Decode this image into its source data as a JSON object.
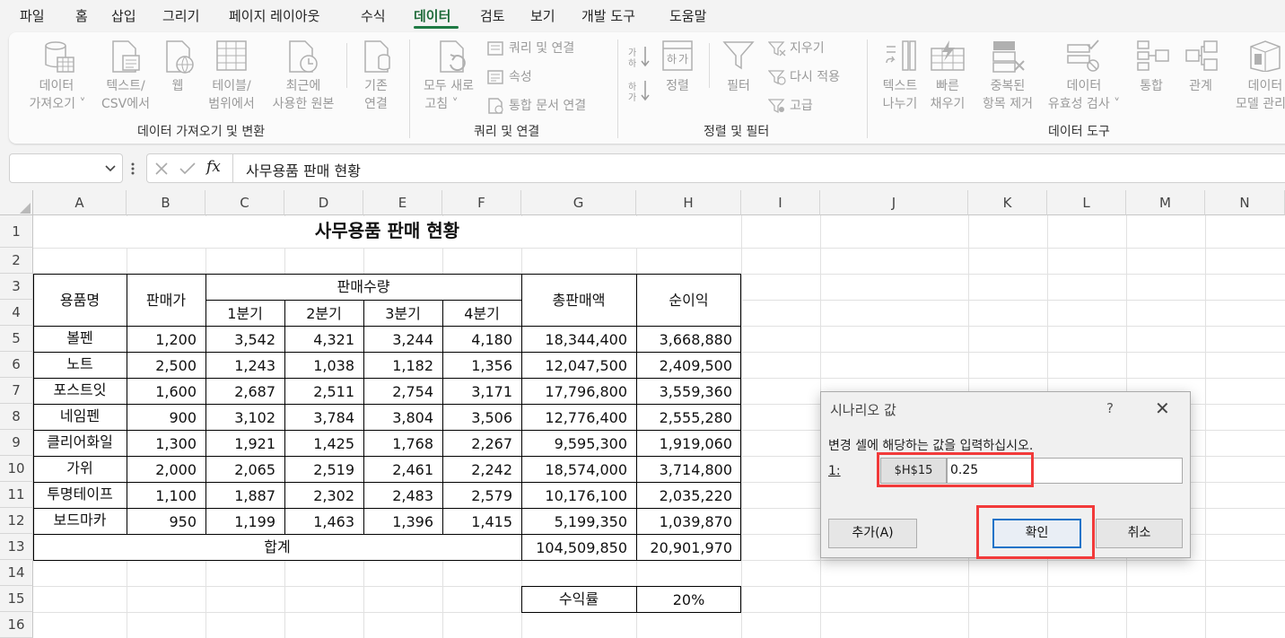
{
  "menu": {
    "items": [
      "파일",
      "홈",
      "삽입",
      "그리기",
      "페이지 레이아웃",
      "수식",
      "데이터",
      "검토",
      "보기",
      "개발 도구",
      "도움말"
    ],
    "active": "데이터"
  },
  "ribbon": {
    "get_data": {
      "line1": "데이터",
      "line2": "가져오기 ˅"
    },
    "from_text": {
      "line1": "텍스트/",
      "line2": "CSV에서"
    },
    "web": {
      "line1": "웹"
    },
    "from_table": {
      "line1": "테이블/",
      "line2": "범위에서"
    },
    "recent": {
      "line1": "최근에",
      "line2": "사용한 원본"
    },
    "existing": {
      "line1": "기존",
      "line2": "연결"
    },
    "group1_label": "데이터 가져오기 및 변환",
    "refresh": {
      "line1": "모두 새로",
      "line2": "고침 ˅"
    },
    "queries_conn": "쿼리 및 연결",
    "properties": "속성",
    "edit_links": "통합 문서 연결",
    "group2_label": "쿼리 및 연결",
    "sort_az": "↓",
    "sort": "정렬",
    "filter": "필터",
    "clear": "지우기",
    "reapply": "다시 적용",
    "advanced": "고급",
    "group3_label": "정렬 및 필터",
    "text_to_col": {
      "line1": "텍스트",
      "line2": "나누기"
    },
    "flash_fill": {
      "line1": "빠른",
      "line2": "채우기"
    },
    "remove_dup": {
      "line1": "중복된",
      "line2": "항목 제거"
    },
    "validation": {
      "line1": "데이터",
      "line2": "유효성 검사 ˅"
    },
    "consolidate": "통합",
    "relations": "관계",
    "data_model": {
      "line1": "데이터",
      "line2": "모델 관리"
    },
    "group4_label": "데이터 도구"
  },
  "formula_bar": {
    "name_box": "",
    "fx": "fx",
    "content": "사무용품 판매 현황"
  },
  "columns": [
    "A",
    "B",
    "C",
    "D",
    "E",
    "F",
    "G",
    "H",
    "I",
    "J",
    "K",
    "L",
    "M",
    "N"
  ],
  "rows": [
    "1",
    "2",
    "3",
    "4",
    "5",
    "6",
    "7",
    "8",
    "9",
    "10",
    "11",
    "12",
    "13",
    "14",
    "15",
    "16"
  ],
  "sheet": {
    "title": "사무용품 판매 현황",
    "headers": {
      "item": "용품명",
      "price": "판매가",
      "qty": "판매수량",
      "q1": "1분기",
      "q2": "2분기",
      "q3": "3분기",
      "q4": "4분기",
      "total": "총판매액",
      "profit": "순이익"
    },
    "data": [
      [
        "볼펜",
        "1,200",
        "3,542",
        "4,321",
        "3,244",
        "4,180",
        "18,344,400",
        "3,668,880"
      ],
      [
        "노트",
        "2,500",
        "1,243",
        "1,038",
        "1,182",
        "1,356",
        "12,047,500",
        "2,409,500"
      ],
      [
        "포스트잇",
        "1,600",
        "2,687",
        "2,511",
        "2,754",
        "3,171",
        "17,796,800",
        "3,559,360"
      ],
      [
        "네임펜",
        "900",
        "3,102",
        "3,784",
        "3,804",
        "3,506",
        "12,776,400",
        "2,555,280"
      ],
      [
        "클리어화일",
        "1,300",
        "1,921",
        "1,425",
        "1,768",
        "2,267",
        "9,595,300",
        "1,919,060"
      ],
      [
        "가위",
        "2,000",
        "2,065",
        "2,519",
        "2,461",
        "2,242",
        "18,574,000",
        "3,714,800"
      ],
      [
        "투명테이프",
        "1,100",
        "1,887",
        "2,302",
        "2,483",
        "2,579",
        "10,176,100",
        "2,035,220"
      ],
      [
        "보드마카",
        "950",
        "1,199",
        "1,463",
        "1,396",
        "1,415",
        "5,199,350",
        "1,039,870"
      ]
    ],
    "sum_label": "합계",
    "sum_total": "104,509,850",
    "sum_profit": "20,901,970",
    "rate_label": "수익률",
    "rate_value": "20%"
  },
  "dialog": {
    "title": "시나리오 값",
    "help": "?",
    "close": "✕",
    "prompt": "변경 셀에 해당하는 값을 입력하십시오.",
    "index": "1:",
    "ref": "$H$15",
    "value": "0.25",
    "add": "추가(A)",
    "ok": "확인",
    "cancel": "취소"
  }
}
